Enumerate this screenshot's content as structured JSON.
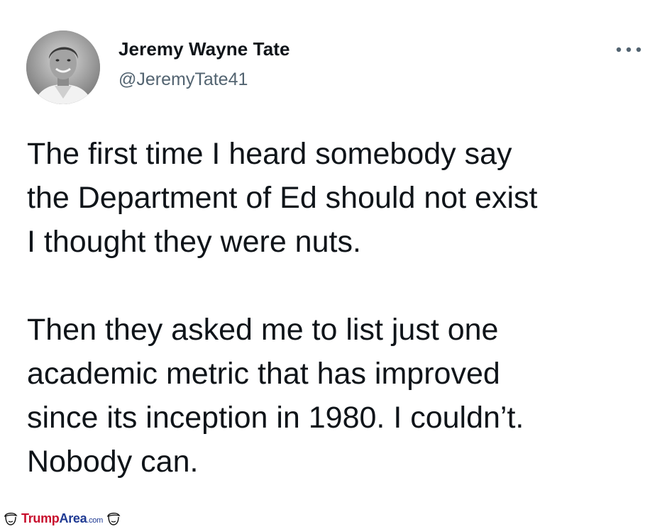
{
  "author": {
    "display_name": "Jeremy Wayne Tate",
    "handle": "@JeremyTate41"
  },
  "tweet": {
    "paragraph_1_lines": [
      "The first time I heard somebody say",
      "the Department of Ed should not exist",
      "I thought they were nuts."
    ],
    "paragraph_2_lines": [
      "Then they asked me to list just one",
      "academic metric that has improved",
      "since its inception in 1980. I couldn’t.",
      "Nobody can."
    ]
  },
  "icons": {
    "more": "more-options-icon",
    "watermark_left": "trump-face-icon",
    "watermark_right": "trump-face-icon"
  },
  "watermark": {
    "part1": "Trump",
    "part2": "Area",
    "part3": ".com",
    "colors": {
      "part1": "#c8102e",
      "part2": "#1f3a93"
    }
  },
  "colors": {
    "text": "#0f1419",
    "secondary": "#536471",
    "background": "#ffffff"
  }
}
